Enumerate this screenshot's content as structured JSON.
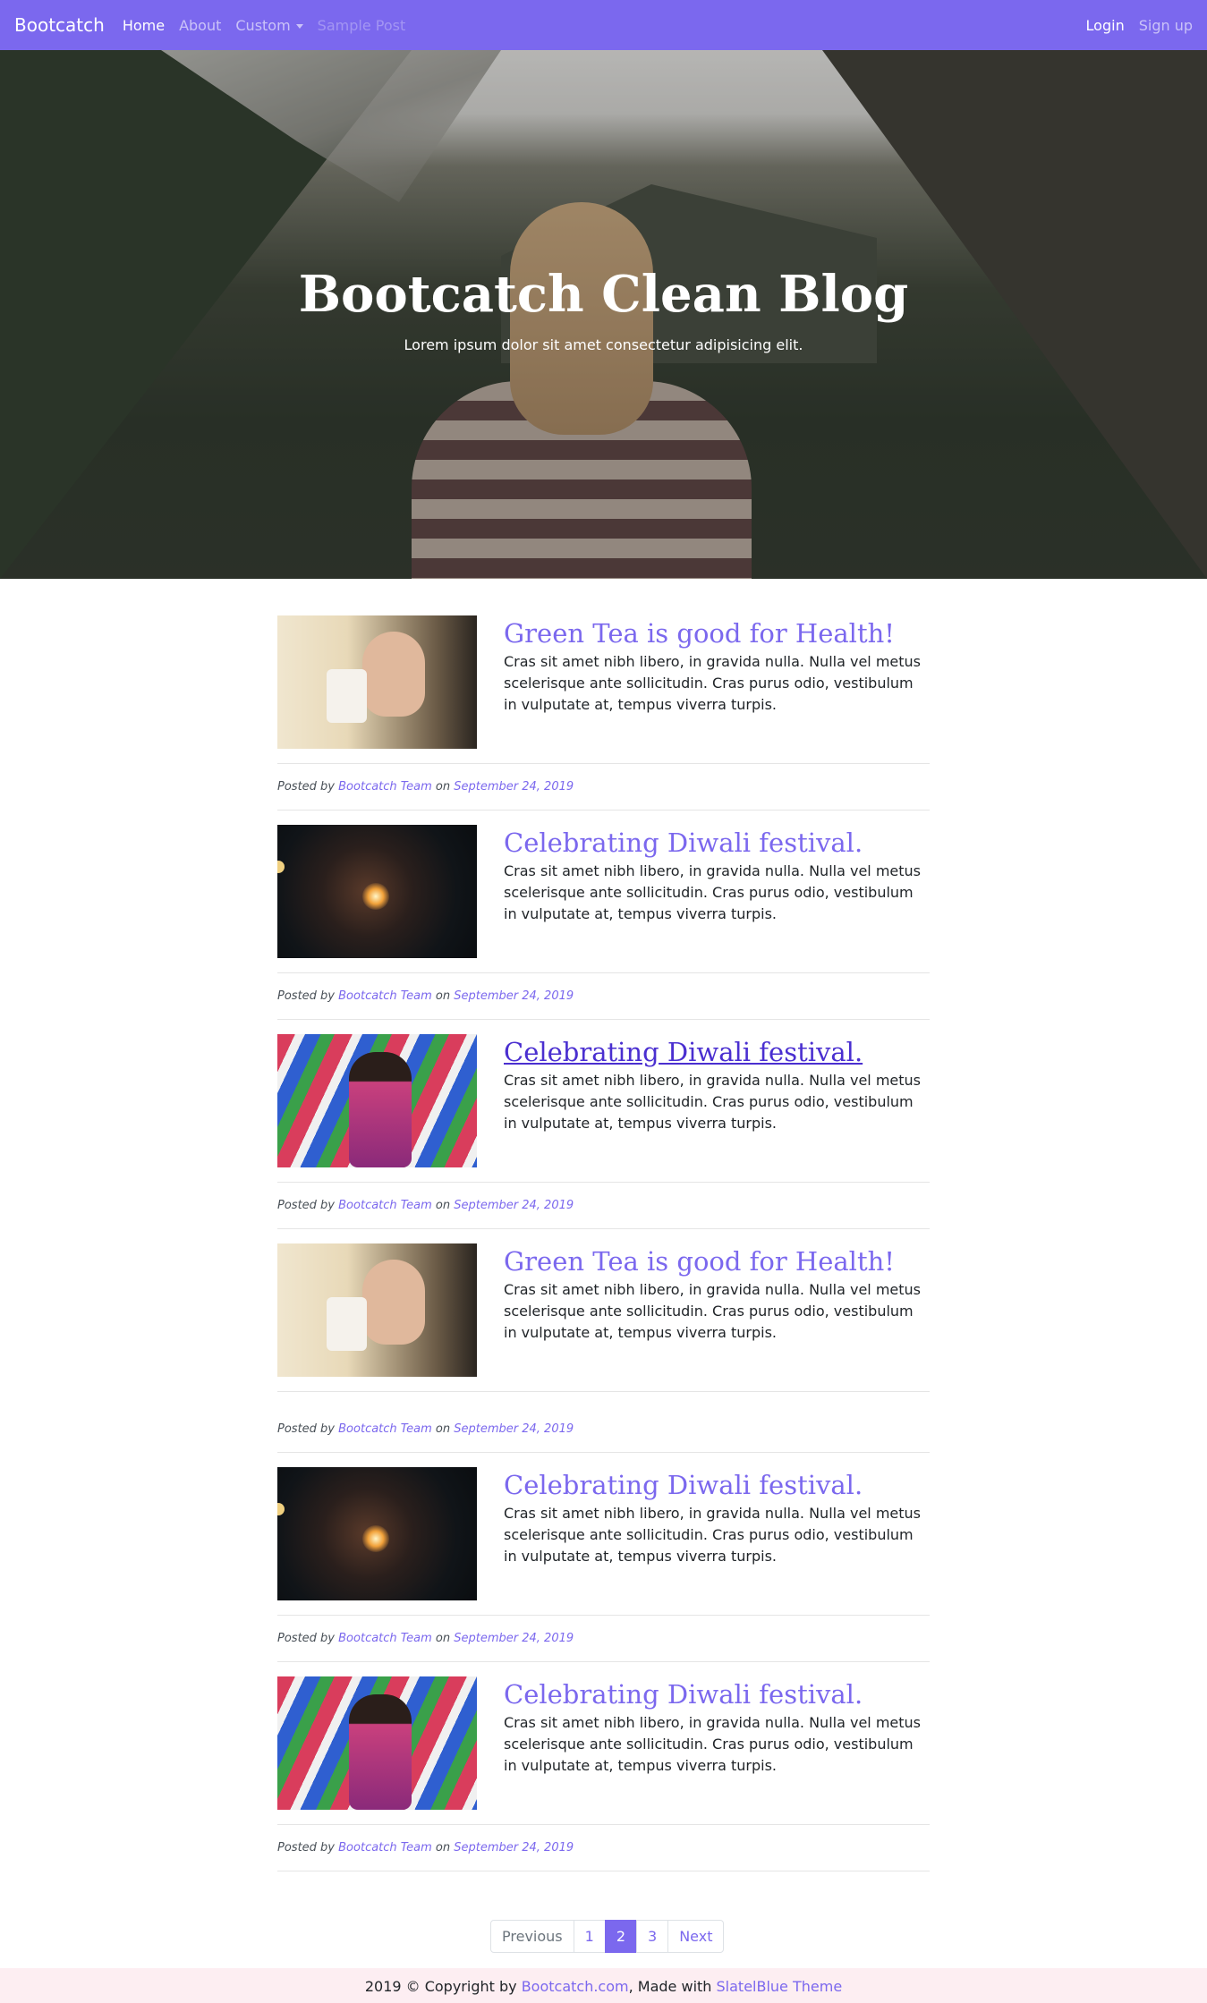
{
  "navbar": {
    "brand": "Bootcatch",
    "links": [
      {
        "label": "Home"
      },
      {
        "label": "About"
      },
      {
        "label": "Custom"
      },
      {
        "label": "Sample Post"
      }
    ],
    "login": "Login",
    "signup": "Sign up",
    "color": "#7b68ee"
  },
  "hero": {
    "title": "Bootcatch Clean Blog",
    "subtitle": "Lorem ipsum dolor sit amet consectetur adipisicing elit."
  },
  "posts": [
    {
      "title": "Green Tea is good for Health!",
      "excerpt": "Cras sit amet nibh libero, in gravida nulla. Nulla vel metus scelerisque ante sollicitudin. Cras purus odio, vestibulum in vulputate at, tempus viverra turpis.",
      "posted_by": "Posted by",
      "author": "Bootcatch Team",
      "on": "on",
      "date": "September 24, 2019",
      "image": "woman-drinking-tea"
    },
    {
      "title": "Celebrating Diwali festival.",
      "excerpt": "Cras sit amet nibh libero, in gravida nulla. Nulla vel metus scelerisque ante sollicitudin. Cras purus odio, vestibulum in vulputate at, tempus viverra turpis.",
      "posted_by": "Posted by",
      "author": "Bootcatch Team",
      "on": "on",
      "date": "September 24, 2019",
      "image": "woman-with-sparkler"
    },
    {
      "title": "Celebrating Diwali festival.",
      "excerpt": "Cras sit amet nibh libero, in gravida nulla. Nulla vel metus scelerisque ante sollicitudin. Cras purus odio, vestibulum in vulputate at, tempus viverra turpis.",
      "posted_by": "Posted by",
      "author": "Bootcatch Team",
      "on": "on",
      "date": "September 24, 2019",
      "image": "woman-in-colorful-flags"
    },
    {
      "title": "Green Tea is good for Health!",
      "excerpt": "Cras sit amet nibh libero, in gravida nulla. Nulla vel metus scelerisque ante sollicitudin. Cras purus odio, vestibulum in vulputate at, tempus viverra turpis.",
      "posted_by": "Posted by",
      "author": "Bootcatch Team",
      "on": "on",
      "date": "September 24, 2019",
      "image": "woman-drinking-tea"
    },
    {
      "title": "Celebrating Diwali festival.",
      "excerpt": "Cras sit amet nibh libero, in gravida nulla. Nulla vel metus scelerisque ante sollicitudin. Cras purus odio, vestibulum in vulputate at, tempus viverra turpis.",
      "posted_by": "Posted by",
      "author": "Bootcatch Team",
      "on": "on",
      "date": "September 24, 2019",
      "image": "woman-with-sparkler"
    },
    {
      "title": "Celebrating Diwali festival.",
      "excerpt": "Cras sit amet nibh libero, in gravida nulla. Nulla vel metus scelerisque ante sollicitudin. Cras purus odio, vestibulum in vulputate at, tempus viverra turpis.",
      "posted_by": "Posted by",
      "author": "Bootcatch Team",
      "on": "on",
      "date": "September 24, 2019",
      "image": "woman-in-colorful-flags"
    }
  ],
  "pagination": {
    "previous": "Previous",
    "pages": [
      "1",
      "2",
      "3"
    ],
    "current": "2",
    "next": "Next"
  },
  "footer": {
    "prefix": "2019 © Copyright by",
    "site": "Bootcatch.com",
    "middle": ", Made with",
    "theme": "SlatelBlue Theme"
  }
}
